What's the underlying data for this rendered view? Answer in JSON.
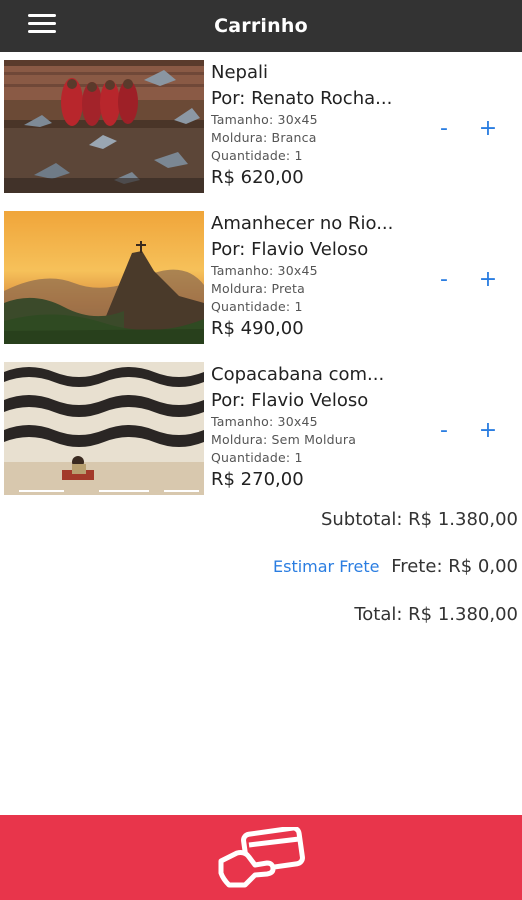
{
  "header": {
    "title": "Carrinho",
    "menu_icon": "hamburger-menu-icon",
    "background": "#333333"
  },
  "items": [
    {
      "name": "Nepali",
      "author": "Por: Renato Rocha...",
      "size": "Tamanho: 30x45",
      "frame": "Moldura: Branca",
      "quantity": "Quantidade: 1",
      "price": "R$ 620,00",
      "minus": "-",
      "plus": "+"
    },
    {
      "name": "Amanhecer no Rio...",
      "author": "Por: Flavio Veloso",
      "size": "Tamanho: 30x45",
      "frame": "Moldura: Preta",
      "quantity": "Quantidade: 1",
      "price": "R$ 490,00",
      "minus": "-",
      "plus": "+"
    },
    {
      "name": "Copacabana com...",
      "author": "Por: Flavio Veloso",
      "size": "Tamanho: 30x45",
      "frame": "Moldura: Sem Moldura",
      "quantity": "Quantidade: 1",
      "price": "R$ 270,00",
      "minus": "-",
      "plus": "+"
    }
  ],
  "summary": {
    "subtotal": "Subtotal: R$ 1.380,00",
    "estimate_shipping": "Estimar Frete",
    "shipping": "Frete: R$ 0,00",
    "total": "Total: R$ 1.380,00"
  },
  "footer": {
    "icon": "card-payment-icon",
    "background": "#e8354b"
  },
  "colors": {
    "accent": "#2a7de1",
    "footer": "#e8354b",
    "header": "#333333"
  }
}
